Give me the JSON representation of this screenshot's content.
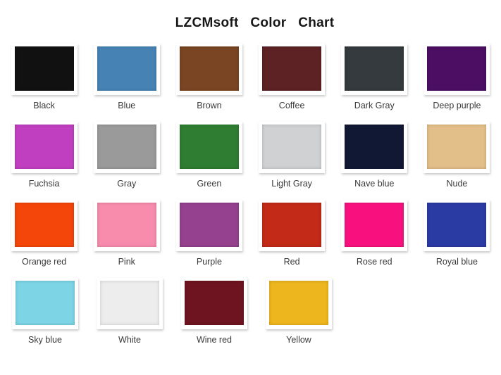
{
  "title": "LZCMsoft   Color   Chart",
  "layout": {
    "rows": 4,
    "columns": 6,
    "swatch_count": 22
  },
  "swatches": [
    {
      "label": "Black",
      "hex": "#111111"
    },
    {
      "label": "Blue",
      "hex": "#4682B4"
    },
    {
      "label": "Brown",
      "hex": "#7A4522"
    },
    {
      "label": "Coffee",
      "hex": "#5C2224"
    },
    {
      "label": "Dark Gray",
      "hex": "#343A3D"
    },
    {
      "label": "Deep purple",
      "hex": "#4B0E63"
    },
    {
      "label": "Fuchsia",
      "hex": "#C03FC0"
    },
    {
      "label": "Gray",
      "hex": "#9A9A9A"
    },
    {
      "label": "Green",
      "hex": "#2E7D32"
    },
    {
      "label": "Light Gray",
      "hex": "#CFD1D3"
    },
    {
      "label": "Nave blue",
      "hex": "#111833"
    },
    {
      "label": "Nude",
      "hex": "#E2BE89"
    },
    {
      "label": "Orange red",
      "hex": "#F4450A"
    },
    {
      "label": "Pink",
      "hex": "#F78CAC"
    },
    {
      "label": "Purple",
      "hex": "#95418F"
    },
    {
      "label": "Red",
      "hex": "#C32A18"
    },
    {
      "label": "Rose red",
      "hex": "#F8117E"
    },
    {
      "label": "Royal blue",
      "hex": "#2A3BA4"
    },
    {
      "label": "Sky blue",
      "hex": "#7CD4E4"
    },
    {
      "label": "White",
      "hex": "#EDEDED"
    },
    {
      "label": "Wine red",
      "hex": "#6E1420"
    },
    {
      "label": "Yellow",
      "hex": "#EDB61E"
    }
  ]
}
